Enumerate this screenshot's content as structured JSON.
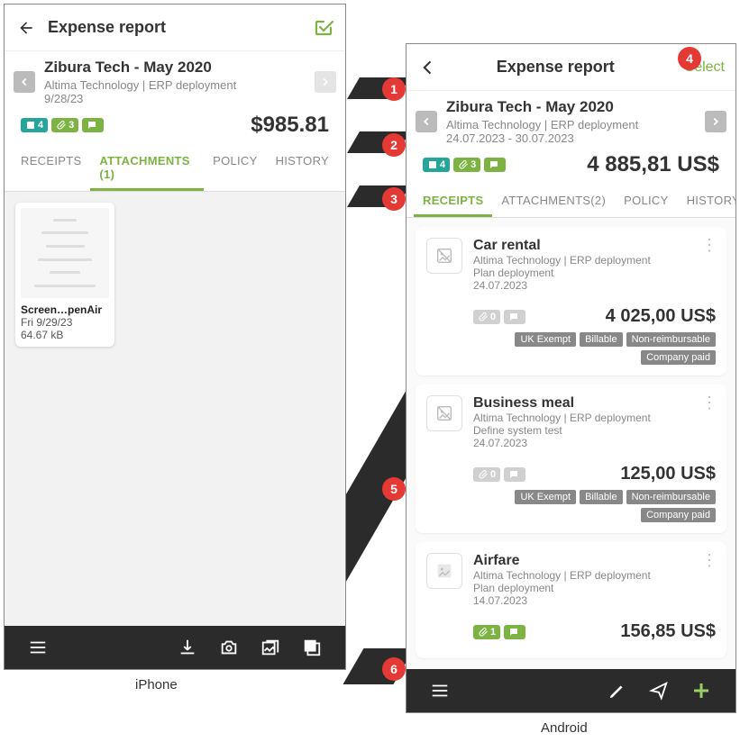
{
  "labels": {
    "iphone": "iPhone",
    "android": "Android"
  },
  "iphone": {
    "header_title": "Expense report",
    "report_title": "Zibura Tech - May 2020",
    "report_meta": "Altima Technology | ERP deployment",
    "report_date": "9/28/23",
    "badge_count_1": "4",
    "badge_count_2": "3",
    "total": "$985.81",
    "tabs": {
      "receipts": "RECEIPTS",
      "attachments": "ATTACHMENTS (1)",
      "policy": "POLICY",
      "history": "HISTORY"
    },
    "attachment": {
      "name": "Screen…penAir",
      "date": "Fri 9/29/23",
      "size": "64.67 kB"
    }
  },
  "android": {
    "header_title": "Expense report",
    "select_label": "Select",
    "report_title": "Zibura Tech - May 2020",
    "report_meta": "Altima Technology | ERP deployment",
    "report_date": "24.07.2023 - 30.07.2023",
    "badge_count_1": "4",
    "badge_count_2": "3",
    "total": "4 885,81 US$",
    "tabs": {
      "receipts": "RECEIPTS",
      "attachments": "ATTACHMENTS(2)",
      "policy": "POLICY",
      "history": "HISTORY"
    },
    "receipts": [
      {
        "title": "Car rental",
        "meta": "Altima Technology | ERP deployment",
        "sub": "Plan deployment",
        "date": "24.07.2023",
        "badge0": "0",
        "amount": "4 025,00 US$",
        "tags": [
          "UK Exempt",
          "Billable",
          "Non-reimbursable",
          "Company paid"
        ]
      },
      {
        "title": "Business meal",
        "meta": "Altima Technology | ERP deployment",
        "sub": "Define system test",
        "date": "24.07.2023",
        "badge0": "0",
        "amount": "125,00 US$",
        "tags": [
          "UK Exempt",
          "Billable",
          "Non-reimbursable",
          "Company paid"
        ]
      },
      {
        "title": "Airfare",
        "meta": "Altima Technology | ERP deployment",
        "sub": "Plan deployment",
        "date": "14.07.2023",
        "badge0": "1",
        "amount": "156,85 US$",
        "tags": []
      }
    ]
  },
  "callouts": [
    "1",
    "2",
    "3",
    "4",
    "5",
    "6"
  ]
}
